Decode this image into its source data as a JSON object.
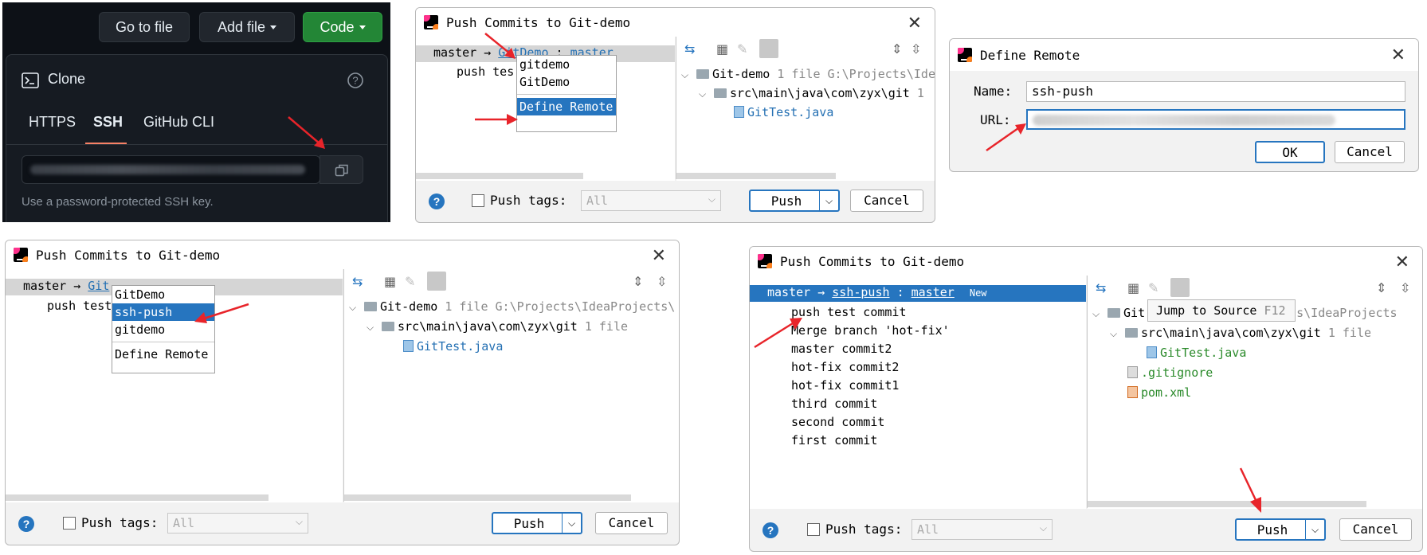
{
  "github": {
    "goto_file": "Go to file",
    "add_file": "Add file",
    "code": "Code",
    "clone_title": "Clone",
    "tabs": [
      "HTTPS",
      "SSH",
      "GitHub CLI"
    ],
    "hint": "Use a password-protected SSH key.",
    "colors": {
      "bg": "#0d1117",
      "green": "#238636",
      "accent": "#f78166"
    }
  },
  "dialog1": {
    "title": "Push Commits to Git-demo",
    "branch_from": "master",
    "arrow": "→",
    "remote": "GitDemo",
    "colon": ":",
    "branch_to": "master",
    "commit_row": "push tes",
    "popup": [
      "gitdemo",
      "GitDemo",
      "Define Remote"
    ],
    "tree_root": "Git-demo",
    "tree_root_meta": "1 file G:\\Projects\\Ide",
    "tree_folder": "src\\main\\java\\com\\zyx\\git",
    "tree_folder_meta": "1",
    "tree_file": "GitTest.java",
    "push_tags": "Push tags:",
    "tags_value": "All",
    "push": "Push",
    "cancel": "Cancel"
  },
  "dialog2": {
    "title": "Define Remote",
    "name_label": "Name:",
    "name_value": "ssh-push",
    "url_label": "URL:",
    "ok": "OK",
    "cancel": "Cancel"
  },
  "dialog3": {
    "title": "Push Commits to Git-demo",
    "branch_from": "master",
    "arrow": "→",
    "remote": "Git",
    "commit_row": "push test",
    "popup": [
      "GitDemo",
      "ssh-push",
      "gitdemo",
      "Define Remote"
    ],
    "tree_root": "Git-demo",
    "tree_root_meta": "1 file G:\\Projects\\IdeaProjects\\",
    "tree_folder": "src\\main\\java\\com\\zyx\\git",
    "tree_folder_meta": "1 file",
    "tree_file": "GitTest.java",
    "push_tags": "Push tags:",
    "tags_value": "All",
    "push": "Push",
    "cancel": "Cancel"
  },
  "dialog4": {
    "title": "Push Commits to Git-demo",
    "branch_from": "master",
    "arrow": "→",
    "remote": "ssh-push",
    "colon": ":",
    "branch_to": "master",
    "badge": "New",
    "commits": [
      "push test commit",
      "Merge branch 'hot-fix'",
      "master commit2",
      "hot-fix commit2",
      "hot-fix commit1",
      "third commit",
      "second commit",
      "first commit"
    ],
    "tooltip": "Jump to Source",
    "tooltip_key": "F12",
    "tree_root": "Git",
    "tree_root_meta": "jects\\IdeaProjects",
    "tree_folder": "src\\main\\java\\com\\zyx\\git",
    "tree_folder_meta": "1 file",
    "tree_file": "GitTest.java",
    "tree_file2": ".gitignore",
    "tree_file3": "pom.xml",
    "push_tags": "Push tags:",
    "tags_value": "All",
    "push": "Push",
    "cancel": "Cancel"
  }
}
